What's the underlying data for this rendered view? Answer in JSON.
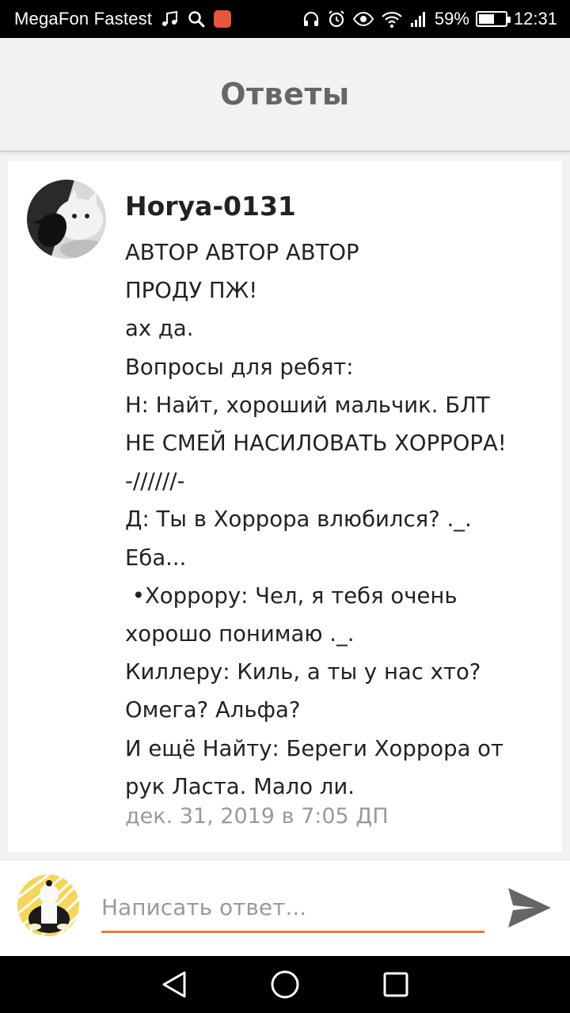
{
  "status_bar": {
    "carrier": "MegaFon Fastest",
    "battery_percent": "59%",
    "battery_level": 0.59,
    "time": "12:31",
    "left_icons": [
      "music-note-icon",
      "search-icon",
      "app-notification-icon"
    ],
    "right_icons": [
      "headphones-icon",
      "alarm-icon",
      "eye-comfort-icon",
      "wifi-icon",
      "signal-icon",
      "battery-icon"
    ]
  },
  "header": {
    "title": "Ответы"
  },
  "comment": {
    "author": "Horya-0131",
    "lines": [
      "АВТОР АВТОР АВТОР",
      "ПРОДУ ПЖ!",
      "ах да.",
      "Вопросы для ребят:",
      "Н: Найт, хороший мальчик. БЛТ",
      "НЕ СМЕЙ НАСИЛОВАТЬ ХОРРОРА!",
      "-//////-",
      "Д: Ты в Хоррора влюбился? ._.",
      "Еба...",
      " •Хоррору: Чел, я тебя очень",
      "хорошо понимаю ._.",
      "Киллеру: Киль, а ты у нас хто?",
      "Омега? Альфа?",
      "И ещё Найту: Береги Хоррора от",
      "рук Ласта. Мало ли."
    ],
    "timestamp": "дек. 31, 2019 в 7:05 ДП"
  },
  "reply": {
    "placeholder": "Написать ответ...",
    "value": ""
  },
  "colors": {
    "accent": "#ee7b2b",
    "header_bg": "#f2f2f2",
    "title": "#666666",
    "timestamp": "#999999",
    "send_icon": "#666666"
  },
  "nav": {
    "icons": [
      "back-icon",
      "home-icon",
      "recents-icon"
    ]
  }
}
